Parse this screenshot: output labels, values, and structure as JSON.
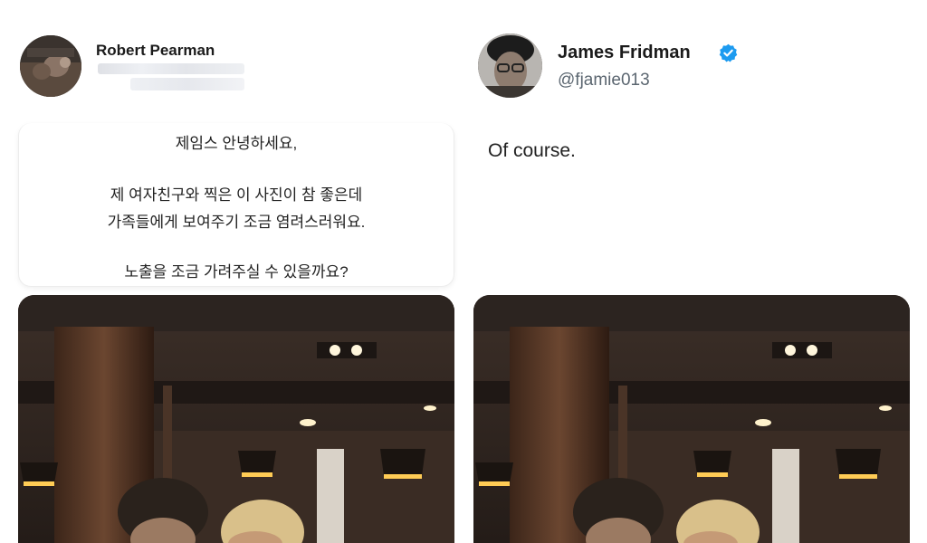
{
  "left_tweet": {
    "author_name": "Robert Pearman",
    "handle_obscured": true,
    "message_lines": [
      "제임스 안녕하세요,",
      "제 여자친구와 찍은 이 사진이 참 좋은데",
      "가족들에게 보여주기 조금 염려스러워요.",
      "노출을 조금 가려주실 수 있을까요?"
    ],
    "avatar": "profile-photo",
    "attachment": "restaurant-couple-photo"
  },
  "right_tweet": {
    "author_name": "James Fridman",
    "handle": "@fjamie013",
    "verified": true,
    "verified_color": "#1d9bf0",
    "reply_text": "Of course.",
    "avatar": "profile-photo-beanie-glasses",
    "attachment": "restaurant-couple-photo-edited"
  },
  "colors": {
    "name": "#1b1b1b",
    "handle": "#5b6670",
    "body_text": "#222222",
    "background": "#ffffff"
  }
}
